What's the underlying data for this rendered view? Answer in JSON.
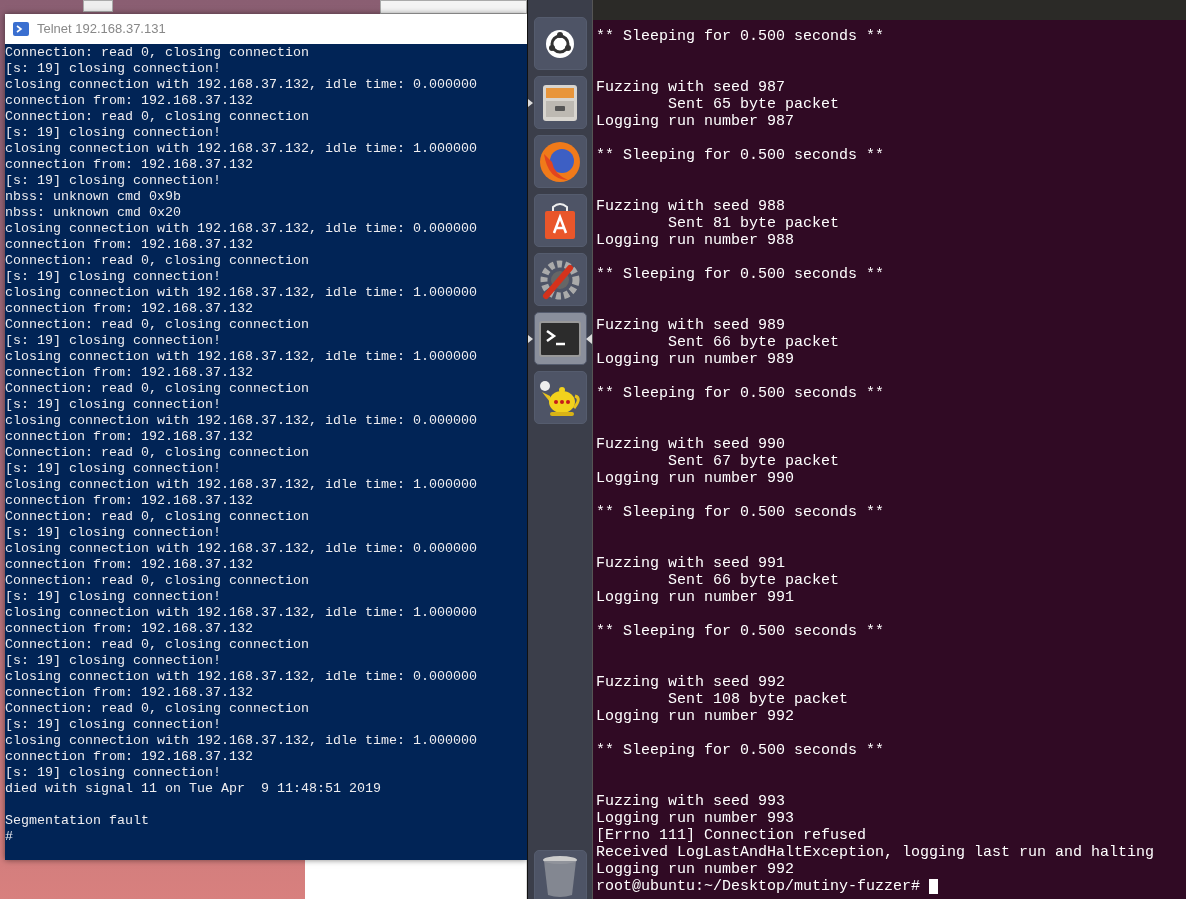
{
  "telnet_window": {
    "title": "Telnet 192.168.37.131",
    "paragraphs": [
      [
        "Connection: read 0, closing connection",
        "[s: 19] closing connection!",
        "closing connection with 192.168.37.132, idle time: 0.000000",
        "connection from: 192.168.37.132",
        "Connection: read 0, closing connection",
        "[s: 19] closing connection!",
        "closing connection with 192.168.37.132, idle time: 1.000000",
        "connection from: 192.168.37.132",
        "[s: 19] closing connection!",
        "nbss: unknown cmd 0x9b",
        "nbss: unknown cmd 0x20",
        "closing connection with 192.168.37.132, idle time: 0.000000",
        "connection from: 192.168.37.132",
        "Connection: read 0, closing connection",
        "[s: 19] closing connection!",
        "closing connection with 192.168.37.132, idle time: 1.000000",
        "connection from: 192.168.37.132",
        "Connection: read 0, closing connection",
        "[s: 19] closing connection!",
        "closing connection with 192.168.37.132, idle time: 1.000000",
        "connection from: 192.168.37.132",
        "Connection: read 0, closing connection",
        "[s: 19] closing connection!",
        "closing connection with 192.168.37.132, idle time: 0.000000",
        "connection from: 192.168.37.132",
        "Connection: read 0, closing connection",
        "[s: 19] closing connection!",
        "closing connection with 192.168.37.132, idle time: 1.000000",
        "connection from: 192.168.37.132",
        "Connection: read 0, closing connection",
        "[s: 19] closing connection!",
        "closing connection with 192.168.37.132, idle time: 0.000000",
        "connection from: 192.168.37.132",
        "Connection: read 0, closing connection",
        "[s: 19] closing connection!",
        "closing connection with 192.168.37.132, idle time: 1.000000",
        "connection from: 192.168.37.132",
        "Connection: read 0, closing connection",
        "[s: 19] closing connection!",
        "closing connection with 192.168.37.132, idle time: 0.000000",
        "connection from: 192.168.37.132",
        "Connection: read 0, closing connection",
        "[s: 19] closing connection!",
        "closing connection with 192.168.37.132, idle time: 1.000000",
        "connection from: 192.168.37.132",
        "[s: 19] closing connection!",
        "died with signal 11 on Tue Apr  9 11:48:51 2019"
      ],
      [
        "Segmentation fault",
        "#"
      ]
    ]
  },
  "launcher": [
    {
      "kind": "ubuntu",
      "running": false,
      "focused": false
    },
    {
      "kind": "files",
      "running": true,
      "focused": false
    },
    {
      "kind": "firefox",
      "running": false,
      "focused": false
    },
    {
      "kind": "store",
      "running": false,
      "focused": false
    },
    {
      "kind": "settings",
      "running": false,
      "focused": false
    },
    {
      "kind": "terminal",
      "running": true,
      "focused": true
    },
    {
      "kind": "teapot",
      "running": false,
      "focused": false
    },
    {
      "kind": "trash",
      "running": false,
      "focused": false
    }
  ],
  "terminal": {
    "blocks": [
      {
        "kind": "status",
        "lines": [
          "** Sleeping for 0.500 seconds **"
        ]
      },
      {
        "kind": "run",
        "lines": [
          "Fuzzing with seed 987",
          "        Sent 65 byte packet",
          "Logging run number 987"
        ]
      },
      {
        "kind": "status",
        "lines": [
          "** Sleeping for 0.500 seconds **"
        ]
      },
      {
        "kind": "run",
        "lines": [
          "Fuzzing with seed 988",
          "        Sent 81 byte packet",
          "Logging run number 988"
        ]
      },
      {
        "kind": "status",
        "lines": [
          "** Sleeping for 0.500 seconds **"
        ]
      },
      {
        "kind": "run",
        "lines": [
          "Fuzzing with seed 989",
          "        Sent 66 byte packet",
          "Logging run number 989"
        ]
      },
      {
        "kind": "status",
        "lines": [
          "** Sleeping for 0.500 seconds **"
        ]
      },
      {
        "kind": "run",
        "lines": [
          "Fuzzing with seed 990",
          "        Sent 67 byte packet",
          "Logging run number 990"
        ]
      },
      {
        "kind": "status",
        "lines": [
          "** Sleeping for 0.500 seconds **"
        ]
      },
      {
        "kind": "run",
        "lines": [
          "Fuzzing with seed 991",
          "        Sent 66 byte packet",
          "Logging run number 991"
        ]
      },
      {
        "kind": "status",
        "lines": [
          "** Sleeping for 0.500 seconds **"
        ]
      },
      {
        "kind": "run",
        "lines": [
          "Fuzzing with seed 992",
          "        Sent 108 byte packet",
          "Logging run number 992"
        ]
      },
      {
        "kind": "status",
        "lines": [
          "** Sleeping for 0.500 seconds **"
        ]
      },
      {
        "kind": "run",
        "lines": [
          "Fuzzing with seed 993",
          "Logging run number 993",
          "[Errno 111] Connection refused",
          "Received LogLastAndHaltException, logging last run and halting",
          "Logging run number 992"
        ]
      }
    ],
    "prompt": "root@ubuntu:~/Desktop/mutiny-fuzzer#"
  }
}
